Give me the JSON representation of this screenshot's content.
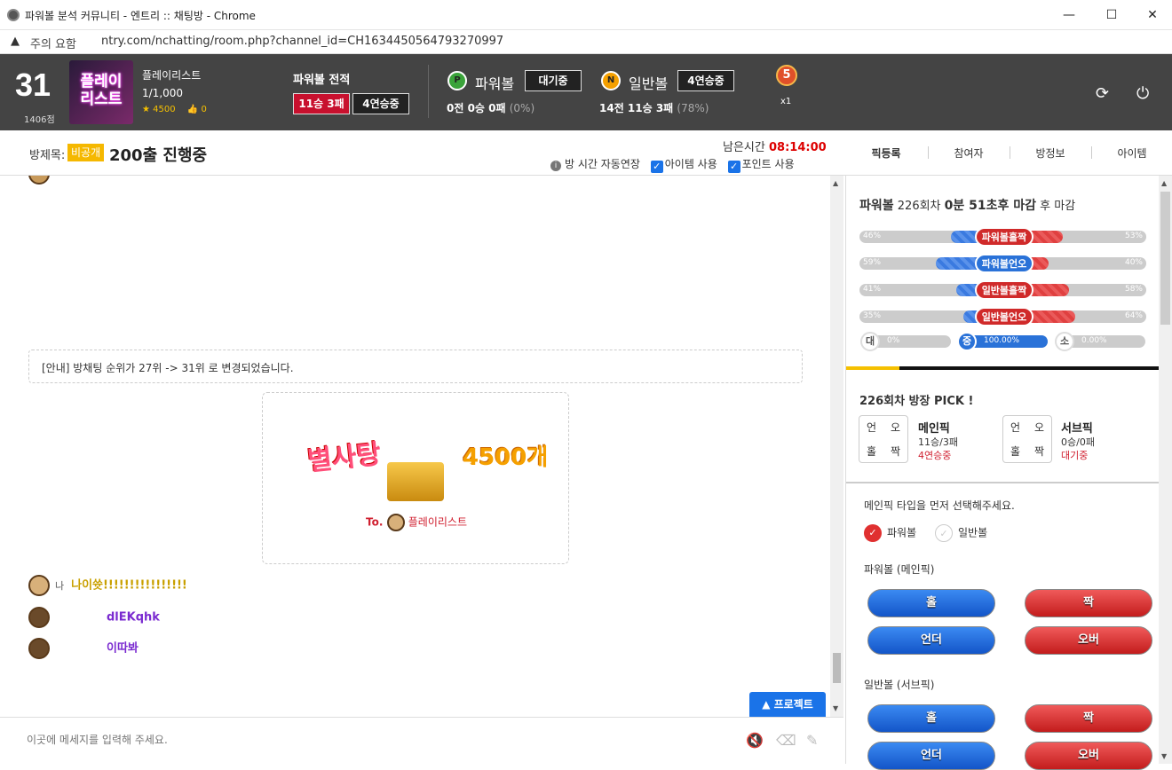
{
  "window": {
    "title": "파워볼 분석 커뮤니티 - 엔트리 :: 채팅방 - Chrome",
    "warning": "주의 요함",
    "url": "ntry.com/nchatting/room.php?channel_id=CH1634450564793270997",
    "controls": [
      "—",
      "☐",
      "✕"
    ]
  },
  "header": {
    "rank": "31",
    "points": "1406점",
    "avatar_text": "플레이\n리스트",
    "nickname": "플레이리스트",
    "members": "1/1,000",
    "stars": "4500",
    "likes": "0",
    "powerball_record_label": "파워볼 전적",
    "record_badge": "11승 3패",
    "streak_badge": "4연승중",
    "powerball": {
      "coin": "P",
      "label": "파워볼",
      "status": "대기중",
      "record": "0전 0승 0패",
      "rate": "(0%)"
    },
    "normalball": {
      "coin": "N",
      "label": "일반볼",
      "status": "4연승중",
      "record": "14전 11승 3패",
      "rate": "(78%)"
    },
    "medal": "5",
    "medal_mult": "x1",
    "colors": {
      "bg": "#444444",
      "red": "#c8102e",
      "gold": "#f5c000"
    }
  },
  "room": {
    "label": "방제목:",
    "badge": "비공개",
    "title": "200출 진행중",
    "remain_label": "남은시간",
    "remain_time": "08:14:00",
    "auto_extend": "방 시간 자동연장",
    "item_use": "아이템 사용",
    "point_use": "포인트 사용",
    "tabs": [
      "픽등록",
      "참여자",
      "방정보",
      "아이템"
    ]
  },
  "chat": {
    "notice": "[안내] 방채팅 순위가 27위 -> 31위 로 변경되었습니다.",
    "gift": {
      "title": "별사탕",
      "count": "4500개",
      "to": "To.",
      "to_name": "플레이리스트"
    },
    "messages": [
      {
        "who": "나",
        "text": "나이쓧!!!!!!!!!!!!!!!!",
        "color": "#c9a000"
      },
      {
        "who": "",
        "text": "dlEKqhk",
        "color": "#7a2ad0"
      },
      {
        "who": "",
        "text": "이따봐",
        "color": "#7a2ad0"
      }
    ],
    "protect": "▲ 프로젝트",
    "input_placeholder": "이곳에 메세지를 입력해 주세요."
  },
  "side": {
    "game": "파워볼",
    "round": "226회차",
    "deadline_a": "0분 51초",
    "deadline_b": "후 마감",
    "deadline_c": "후 마감",
    "bars": [
      {
        "left_pct": "46%",
        "right_pct": "53%",
        "label": "파워볼홀짝",
        "mid": "red",
        "lv": 46,
        "rv": 53
      },
      {
        "left_pct": "59%",
        "right_pct": "40%",
        "label": "파워볼언오",
        "mid": "blue",
        "lv": 59,
        "rv": 40
      },
      {
        "left_pct": "41%",
        "right_pct": "58%",
        "label": "일반볼홀짝",
        "mid": "red",
        "lv": 41,
        "rv": 58
      },
      {
        "left_pct": "35%",
        "right_pct": "64%",
        "label": "일반볼언오",
        "mid": "red",
        "lv": 35,
        "rv": 64
      }
    ],
    "size_bars": [
      {
        "c": "대",
        "v": "0%",
        "fill": 0
      },
      {
        "c": "중",
        "v": "100.00%",
        "fill": 100
      },
      {
        "c": "소",
        "v": "0.00%",
        "fill": 0
      }
    ],
    "pick_head": "226회차 방장 PICK !",
    "grid": [
      "언",
      "오",
      "홀",
      "짝"
    ],
    "main_pick": {
      "title": "메인픽",
      "record": "11승/3패",
      "status": "4연승중"
    },
    "sub_pick": {
      "title": "서브픽",
      "record": "0승/0패",
      "status": "대기중"
    },
    "guide": "메인픽 타입을 먼저 선택해주세요.",
    "radio_powerball": "파워볼",
    "radio_normal": "일반볼",
    "main_label": "파워볼 (메인픽)",
    "sub_label": "일반볼 (서브픽)",
    "btn_odd": "홀",
    "btn_even": "짝",
    "btn_under": "언더",
    "btn_over": "오버"
  }
}
